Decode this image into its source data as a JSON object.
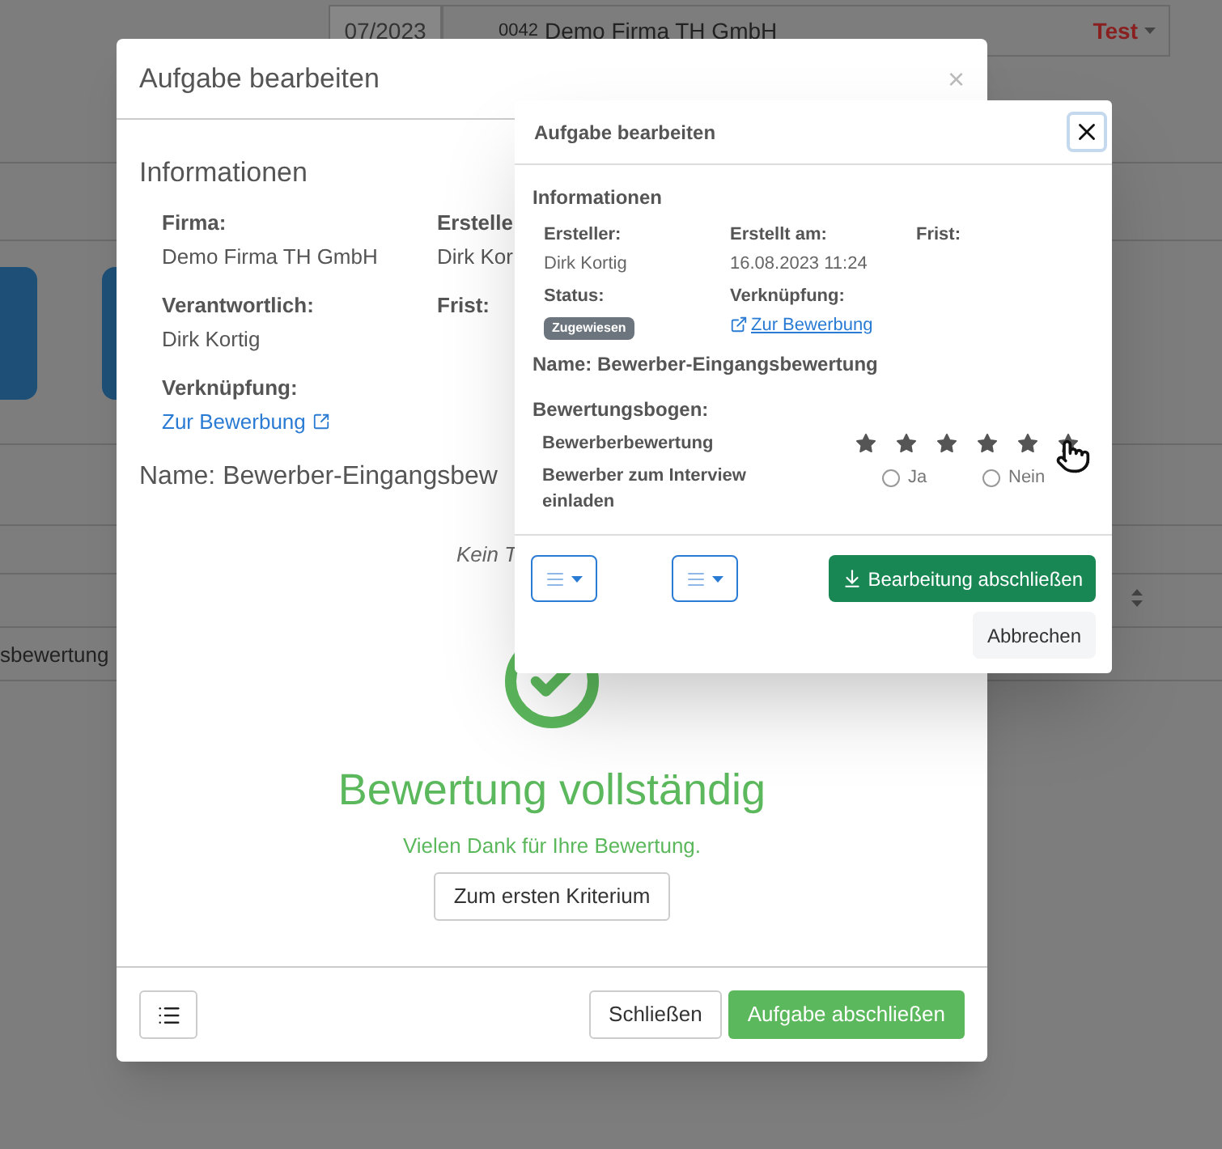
{
  "background_page": {
    "period": "07/2023",
    "company_number": "0042",
    "company": "Demo Firma TH GmbH",
    "status": "Test",
    "table_cell": "sbewertung"
  },
  "task_modal": {
    "title": "Aufgabe bearbeiten",
    "close_label": "×",
    "info_heading": "Informationen",
    "fields": [
      {
        "label": "Firma:",
        "value": "Demo Firma TH GmbH",
        "kind": "text"
      },
      {
        "label": "Erstelle",
        "value": "Dirk Kor",
        "kind": "text"
      },
      {
        "label": "Verantwortlich:",
        "value": "Dirk Kortig",
        "kind": "text"
      },
      {
        "label": "Frist:",
        "kind": "text"
      },
      {
        "label": "Verknüpfung:",
        "value": "Zur Bewerbung",
        "kind": "link"
      }
    ],
    "name": "Name: Bewerber-Eingangsbew",
    "notice": "Kein T",
    "completion": {
      "title": "Bewertung vollständig",
      "message": "Vielen Dank für Ihre Bewertung.",
      "button": "Zum ersten Kriterium"
    },
    "footer_buttons": [
      "Schließen",
      "Aufgabe abschließen"
    ]
  },
  "popup": {
    "title": "Aufgabe bearbeiten",
    "info_heading": "Informationen",
    "fields": [
      {
        "label": "Ersteller:",
        "value": "Dirk Kortig",
        "kind": "text"
      },
      {
        "label": "Erstellt am:",
        "value": "16.08.2023 11:24",
        "kind": "text"
      },
      {
        "label": "Frist:",
        "kind": "text"
      },
      {
        "label": "Status:",
        "value": "Zugewiesen",
        "kind": "badge"
      },
      {
        "label": "Verknüpfung:",
        "value": "Zur Bewerbung",
        "kind": "link"
      }
    ],
    "name": "Name: Bewerber-Eingangsbewertung",
    "form_heading": "Bewertungsbogen:",
    "criteria": [
      {
        "kind": "stars",
        "label": "Bewerberbewertung",
        "stars": 0
      },
      {
        "kind": "radio",
        "label": "Bewerber zum Interview einladen",
        "options": [
          {
            "label": "Ja",
            "selected": false
          },
          {
            "label": "Nein",
            "selected": false
          }
        ]
      }
    ],
    "primary_button": "Bearbeitung abschließen",
    "cancel_button": "Abbrechen"
  }
}
